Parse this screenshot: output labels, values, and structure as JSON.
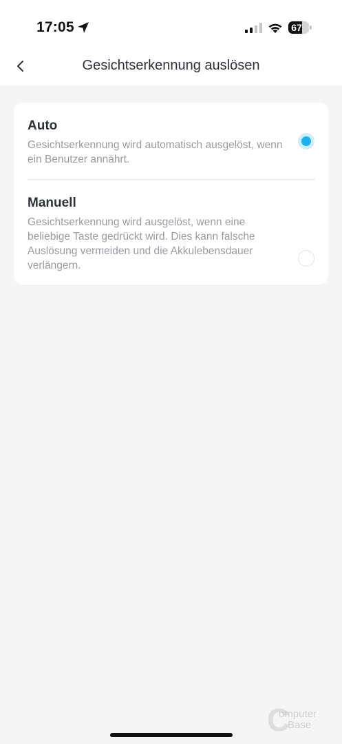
{
  "status_bar": {
    "time": "17:05",
    "battery_level": "67",
    "icons": [
      "location-arrow-icon",
      "cellular-signal-icon",
      "wifi-icon",
      "battery-icon"
    ]
  },
  "nav": {
    "back_icon": "chevron-left-icon",
    "title": "Gesichtserkennung auslösen"
  },
  "options": [
    {
      "label": "Auto",
      "description": "Gesichtserkennung wird automatisch ausgelöst, wenn ein Benutzer annährt.",
      "selected": true
    },
    {
      "label": "Manuell",
      "description": "Gesichtserkennung wird ausgelöst, wenn eine beliebige Taste gedrückt wird. Dies kann falsche Auslösung vermeiden und die Akkulebensdauer verlängern.",
      "selected": false
    }
  ],
  "colors": {
    "accent": "#1eb0e8",
    "background": "#f5f5f5",
    "card": "#ffffff"
  },
  "watermark": {
    "line1": "omputer",
    "line2": "Base"
  }
}
